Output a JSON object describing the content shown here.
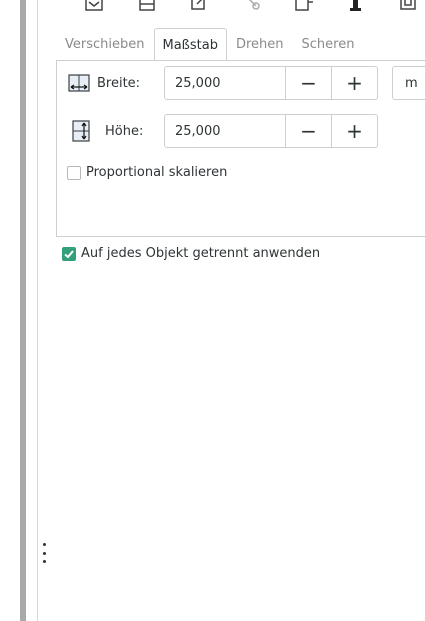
{
  "tabs": [
    {
      "label": "Verschieben",
      "active": false
    },
    {
      "label": "Maßstab",
      "active": true
    },
    {
      "label": "Drehen",
      "active": false
    },
    {
      "label": "Scheren",
      "active": false
    }
  ],
  "scale": {
    "width": {
      "label": "Breite:",
      "value": "25,000",
      "minus": "−",
      "plus": "+",
      "icon": "scale-width-icon"
    },
    "height": {
      "label": "Höhe:",
      "value": "25,000",
      "minus": "−",
      "plus": "+",
      "icon": "scale-height-icon"
    },
    "unit_fragment": "m",
    "proportional": {
      "label": "Proportional skalieren",
      "checked": false
    }
  },
  "apply_each": {
    "label": "Auf jedes Objekt getrennt anwenden",
    "checked": true
  },
  "colors": {
    "accent": "#33a07c",
    "border": "#cfcfcf",
    "text": "#2e3436",
    "inactive_tab": "#8a8a8a"
  }
}
